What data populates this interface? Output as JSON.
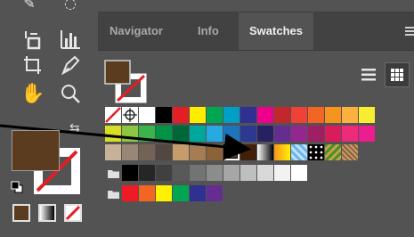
{
  "panel": {
    "tabs": [
      {
        "label": "Navigator",
        "active": false
      },
      {
        "label": "Info",
        "active": false
      },
      {
        "label": "Swatches",
        "active": true
      }
    ],
    "view_modes": [
      "list-view-icon",
      "thumbnail-view-icon"
    ],
    "selected_view": "thumbnail-view-icon"
  },
  "toolbar": {
    "fill_color": "#5b3c1e",
    "stroke": "none",
    "tools": [
      "artboard-tool-icon",
      "column-graph-tool-icon",
      "crop-tool-icon",
      "pen-tool-icon",
      "hand-tool-icon",
      "zoom-tool-icon"
    ],
    "modes": [
      "color",
      "gradient",
      "none"
    ]
  },
  "swatches": {
    "row1": [
      "none",
      "registration",
      "#ffffff",
      "#000000",
      "#e31e24",
      "#ffed00",
      "#00a650",
      "#00a0c6",
      "#2e3192",
      "#ec008c",
      "#c1272d",
      "#ef4136",
      "#f26522",
      "#f7941d",
      "#fbb040",
      "#f9ed32"
    ],
    "row2": [
      "#d7df23",
      "#8dc63f",
      "#39b54a",
      "#009444",
      "#006838",
      "#00a79d",
      "#27aae1",
      "#1c75bc",
      "#2b3990",
      "#262262",
      "#662d91",
      "#92278f",
      "#9e1f63",
      "#da1c5c",
      "#ee2a7b",
      "#ed1c8f"
    ],
    "row3": [
      "#c7b299",
      "#998675",
      "#736357",
      "#534741",
      "#c69c6d",
      "#a67c52",
      "#8c6239",
      "#5b3c1e",
      "#42210b",
      "gradient-bw",
      "gradient-orange",
      "pattern-blue",
      "pattern-dots",
      "pattern-leaves",
      "pattern-brown"
    ],
    "row4": [
      "folder",
      "#000000",
      "#262626",
      "#404040",
      "#595959",
      "#737373",
      "#8c8c8c",
      "#a6a6a6",
      "#bfbfbf",
      "#d9d9d9",
      "#f2f2f2",
      "#ffffff"
    ],
    "row5": [
      "folder",
      "#ed1c24",
      "#f26522",
      "#fff200",
      "#00a651",
      "#2e3192",
      "#662d91"
    ]
  }
}
